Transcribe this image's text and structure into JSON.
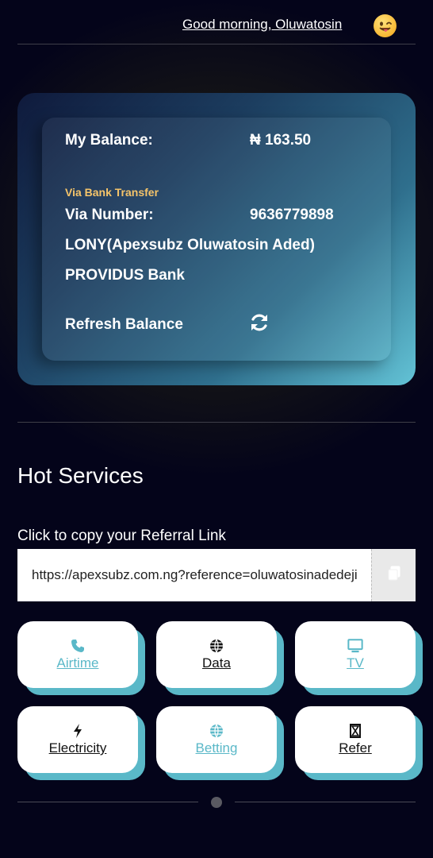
{
  "header": {
    "greeting": "Good morning, Oluwatosin",
    "emoji_icon": "winking-tongue-face-emoji"
  },
  "wallet": {
    "balance_label": "My Balance:",
    "balance_value": "₦ 163.50",
    "via_transfer": "Via Bank Transfer",
    "via_number_label": "Via Number:",
    "via_number_value": "9636779898",
    "account_name": "LONY(Apexsubz Oluwatosin Aded)",
    "bank_name": "PROVIDUS Bank",
    "refresh_label": "Refresh Balance",
    "refresh_icon": "sync-icon"
  },
  "hot_services": {
    "title": "Hot Services",
    "referral_label": "Click to copy your Referral Link",
    "referral_link": "https://apexsubz.com.ng?reference=oluwatosinadedeji",
    "copy_icon": "copy-icon",
    "items": [
      {
        "label": "Airtime",
        "icon": "phone-icon",
        "active": true
      },
      {
        "label": "Data",
        "icon": "globe-icon",
        "active": false
      },
      {
        "label": "TV",
        "icon": "tv-icon",
        "active": true
      },
      {
        "label": "Electricity",
        "icon": "bolt-icon",
        "active": false
      },
      {
        "label": "Betting",
        "icon": "globe-icon",
        "active": true
      },
      {
        "label": "Refer",
        "icon": "hourglass-icon",
        "active": false
      }
    ]
  },
  "colors": {
    "accent": "#5ab8c8",
    "highlight": "#f5c46a",
    "background": "#04041a"
  }
}
